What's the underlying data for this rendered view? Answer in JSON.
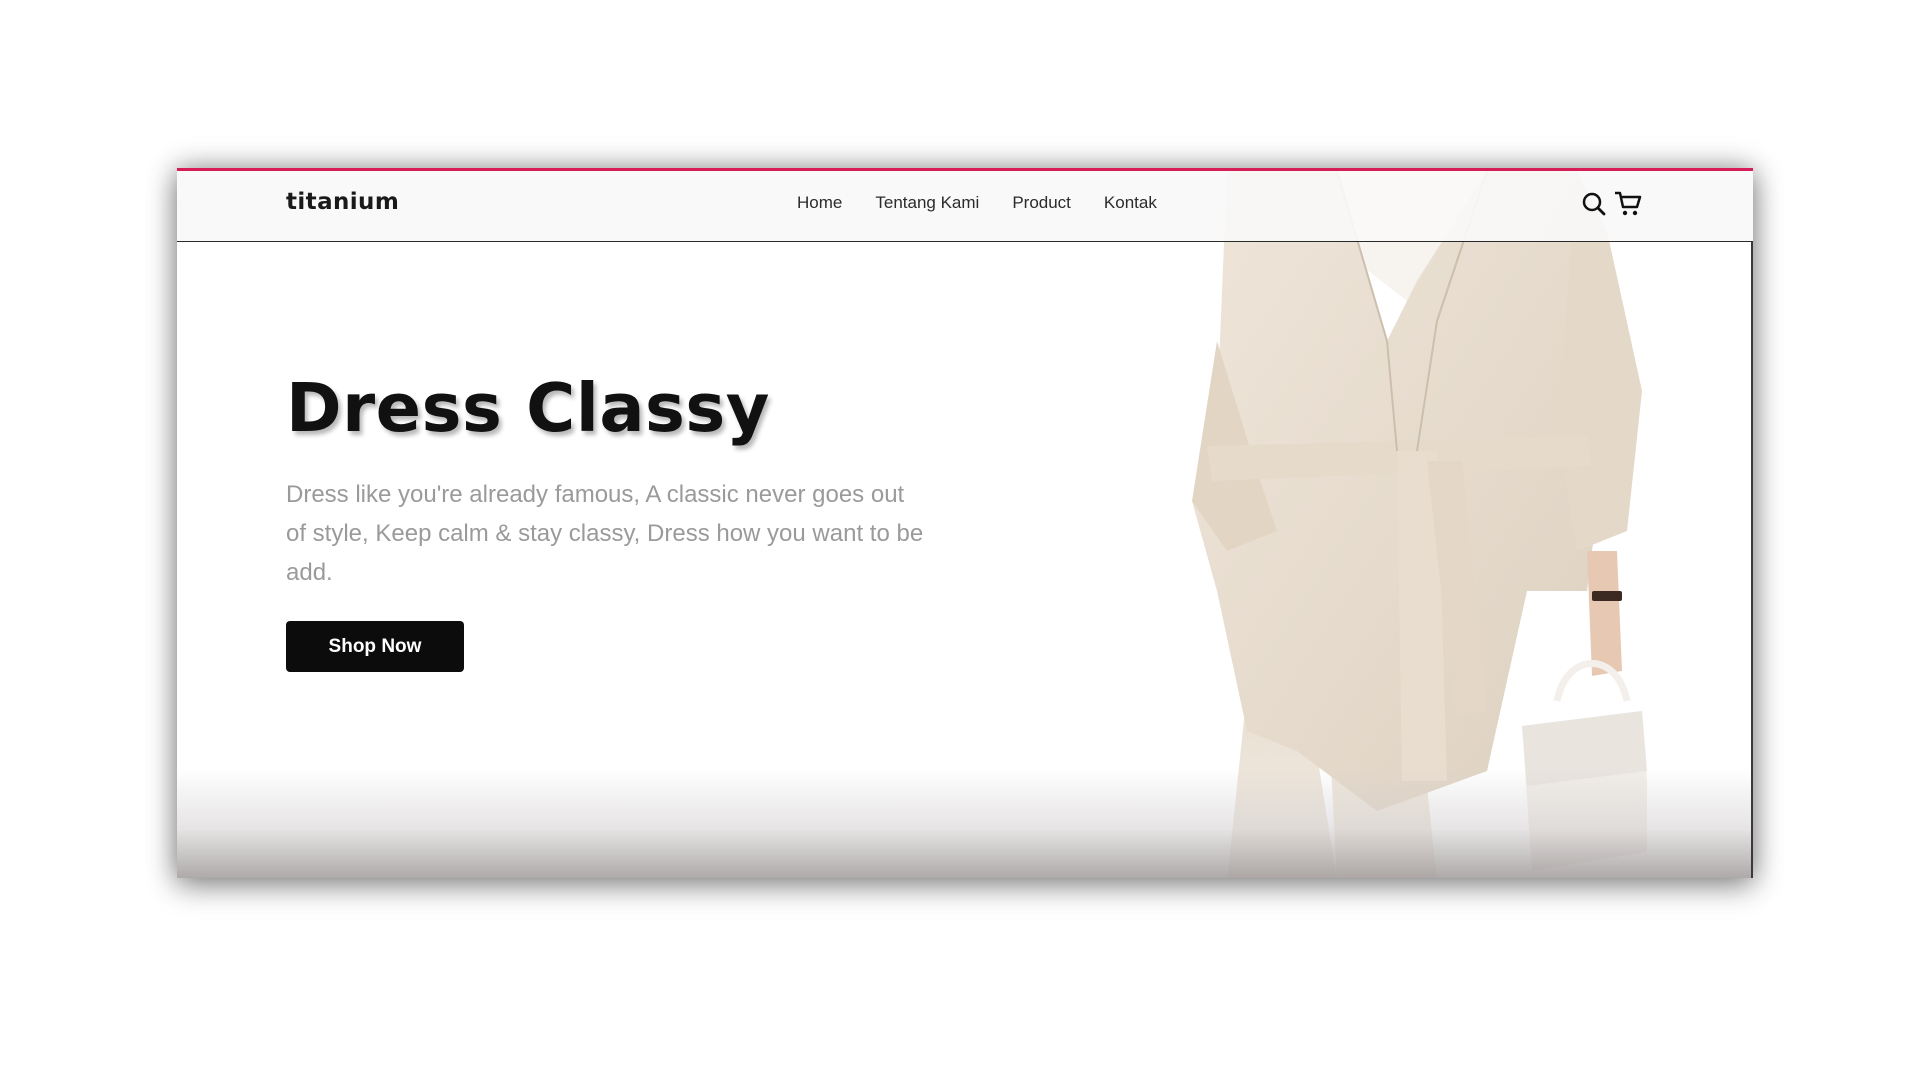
{
  "brand": {
    "name": "titanium"
  },
  "nav": {
    "links": [
      "Home",
      "Tentang Kami",
      "Product",
      "Kontak"
    ]
  },
  "icons": {
    "search": "search-icon",
    "cart": "cart-icon"
  },
  "hero": {
    "title": "Dress Classy",
    "description": "Dress like you're already famous, A classic never goes out of style, Keep calm & stay classy, Dress how you want to be add.",
    "cta_label": "Shop Now"
  },
  "colors": {
    "accent_top": "#d61d58",
    "button_bg": "#0c0c0c",
    "garment": "#e8ddd0"
  }
}
